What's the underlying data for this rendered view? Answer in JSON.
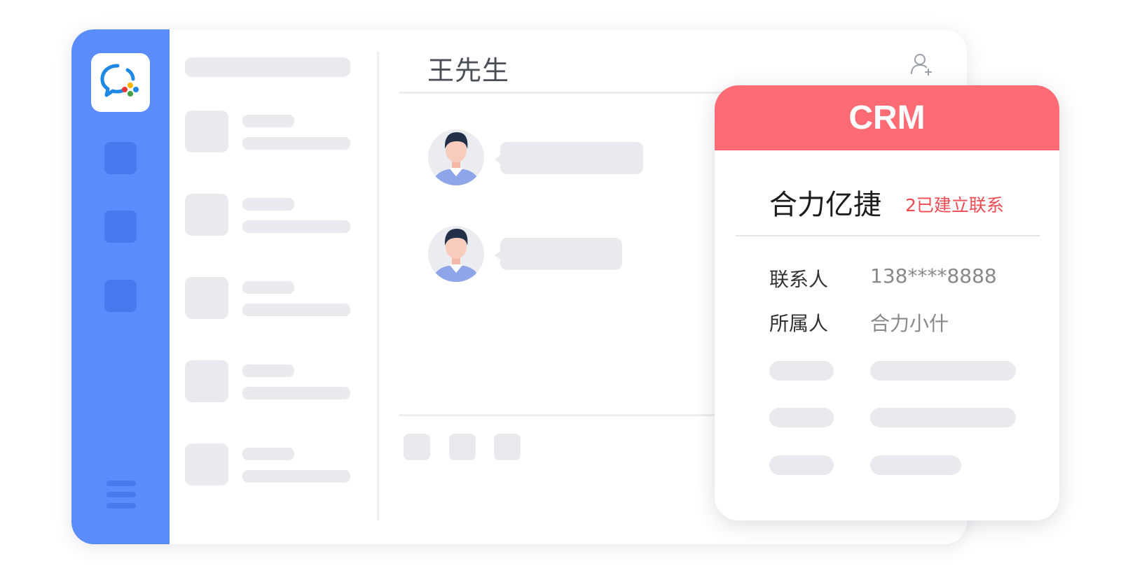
{
  "chat": {
    "title": "王先生"
  },
  "crm": {
    "header": "CRM",
    "company": "合力亿捷",
    "status": "2已建立联系",
    "fields": [
      {
        "label": "联系人",
        "value": "138****8888"
      },
      {
        "label": "所属人",
        "value": "合力小什"
      }
    ]
  },
  "icons": {
    "logo": "wecom-chat-logo-icon",
    "add_contact": "add-contact-icon",
    "menu": "hamburger-menu-icon"
  },
  "colors": {
    "sidebar": "#5b8cfb",
    "sidebar_item": "#4a78ee",
    "crm_header": "#ff6b74",
    "status_text": "#f04a52",
    "placeholder": "#e8eaee"
  }
}
